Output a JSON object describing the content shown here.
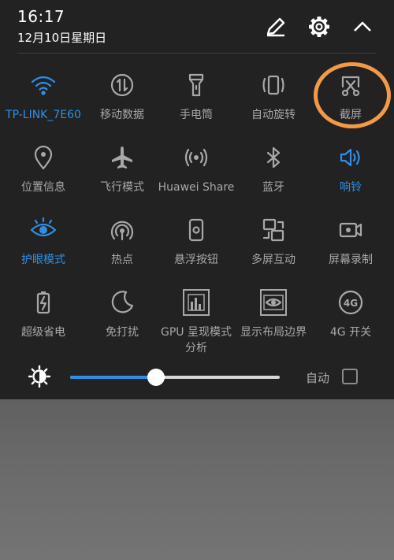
{
  "header": {
    "time": "16:17",
    "date": "12月10日星期日"
  },
  "toggles": [
    {
      "label": "TP-LINK_7E60",
      "icon": "wifi-icon",
      "active": true
    },
    {
      "label": "移动数据",
      "icon": "mobile-data-icon",
      "active": false
    },
    {
      "label": "手电筒",
      "icon": "flashlight-icon",
      "active": false
    },
    {
      "label": "自动旋转",
      "icon": "auto-rotate-icon",
      "active": false
    },
    {
      "label": "截屏",
      "icon": "screenshot-icon",
      "active": false
    },
    {
      "label": "位置信息",
      "icon": "location-icon",
      "active": false
    },
    {
      "label": "飞行模式",
      "icon": "airplane-icon",
      "active": false
    },
    {
      "label": "Huawei Share",
      "icon": "huawei-share-icon",
      "active": false
    },
    {
      "label": "蓝牙",
      "icon": "bluetooth-icon",
      "active": false
    },
    {
      "label": "响铃",
      "icon": "volume-icon",
      "active": true
    },
    {
      "label": "护眼模式",
      "icon": "eye-comfort-icon",
      "active": true
    },
    {
      "label": "热点",
      "icon": "hotspot-icon",
      "active": false
    },
    {
      "label": "悬浮按钮",
      "icon": "floating-button-icon",
      "active": false
    },
    {
      "label": "多屏互动",
      "icon": "multi-screen-icon",
      "active": false
    },
    {
      "label": "屏幕录制",
      "icon": "screen-record-icon",
      "active": false
    },
    {
      "label": "超级省电",
      "icon": "battery-saver-icon",
      "active": false
    },
    {
      "label": "免打扰",
      "icon": "do-not-disturb-icon",
      "active": false
    },
    {
      "label": "GPU 呈现模式\n分析",
      "icon": "gpu-rendering-icon",
      "active": false
    },
    {
      "label": "显示布局边界",
      "icon": "layout-bounds-icon",
      "active": false
    },
    {
      "label": "4G 开关",
      "icon": "4g-icon",
      "active": false
    }
  ],
  "brightness": {
    "level": 0.41,
    "auto_label": "自动",
    "auto_checked": false
  },
  "colors": {
    "accent": "#2f8fe8",
    "panel": "#222222",
    "inactive": "#a8a8a8",
    "annotation": "#f49a46"
  }
}
